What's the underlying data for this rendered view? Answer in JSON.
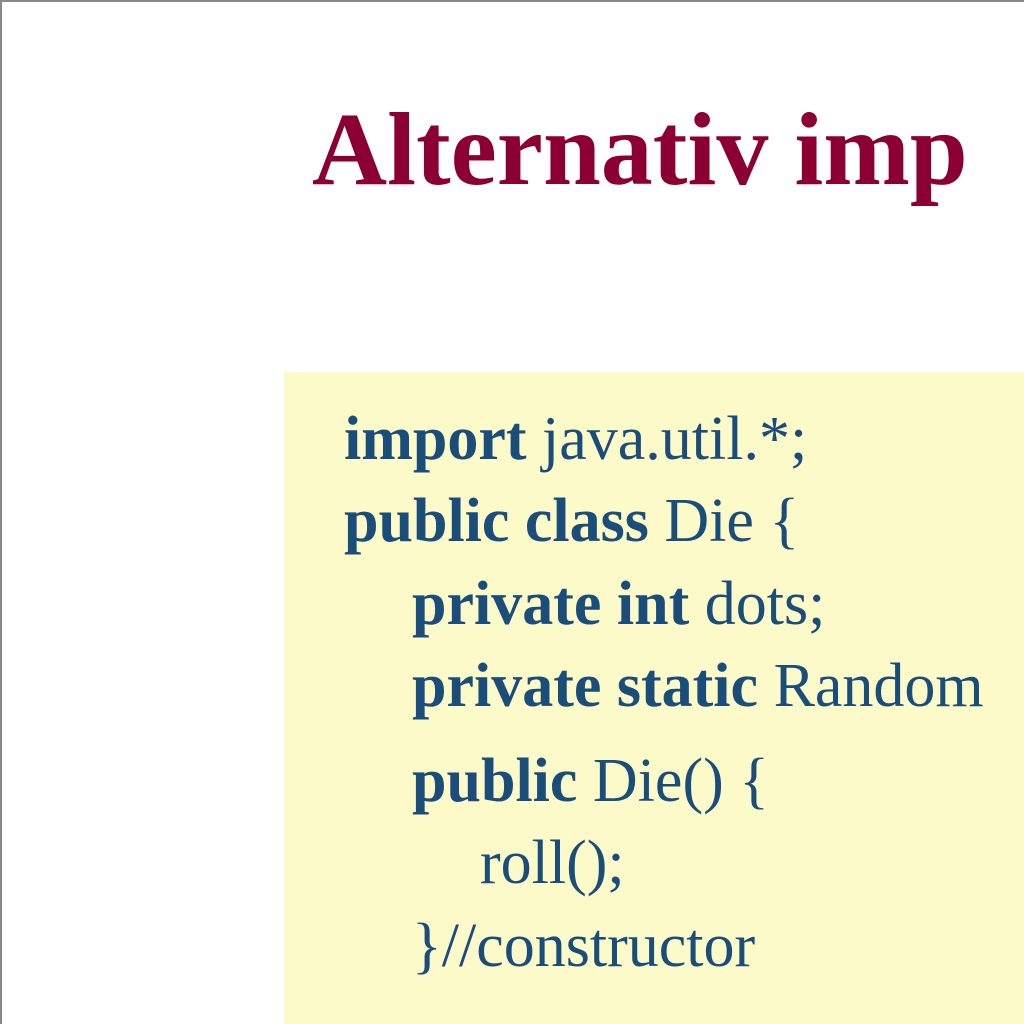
{
  "title": "Alternativ imp",
  "code": {
    "line1_kw": "import",
    "line1_rest": " java.util.*;",
    "line2_kw": "public class",
    "line2_rest": " Die {",
    "line3_kw": "private int",
    "line3_rest": " dots;",
    "line4_kw": "private static",
    "line4_rest": " Random",
    "line5_kw": "public",
    "line5_rest": " Die() {",
    "line6": "roll();",
    "line7": "}//constructor"
  }
}
